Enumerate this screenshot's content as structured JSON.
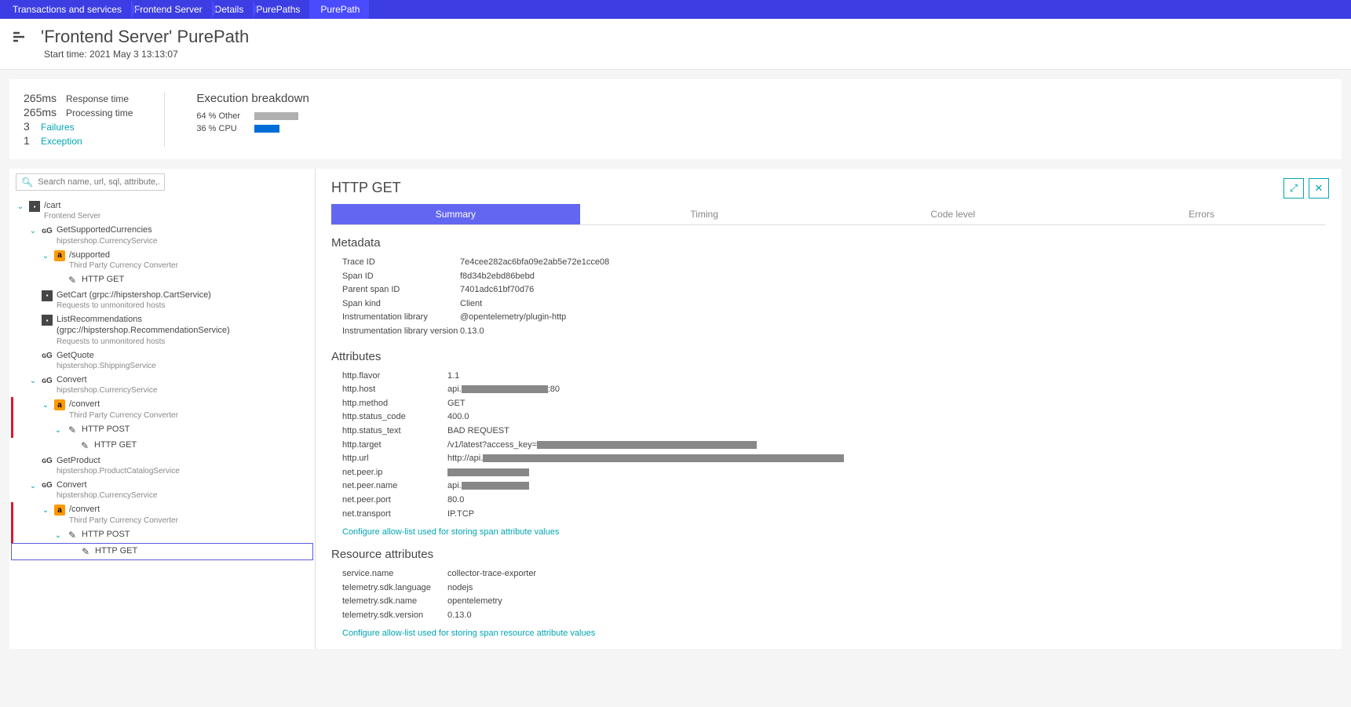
{
  "breadcrumbs": [
    "Transactions and services",
    "Frontend Server",
    "Details",
    "PurePaths",
    "PurePath"
  ],
  "header": {
    "title": "'Frontend Server' PurePath",
    "subtitle": "Start time: 2021 May 3 13:13:07"
  },
  "summary": {
    "response_time_value": "265ms",
    "response_time_label": "Response time",
    "processing_time_value": "265ms",
    "processing_time_label": "Processing time",
    "failures_count": "3",
    "failures_label": "Failures",
    "exceptions_count": "1",
    "exceptions_label": "Exception",
    "exec_title": "Execution breakdown",
    "other_pct": "64 % Other",
    "other_bar_width": 56,
    "cpu_pct": "36 % CPU",
    "cpu_bar_width": 32
  },
  "search": {
    "placeholder": "Search name, url, sql, attribute,..."
  },
  "tree": [
    {
      "indent": 0,
      "chev": true,
      "icon": "dark",
      "title": "/cart",
      "sub": "Frontend Server",
      "err": false
    },
    {
      "indent": 1,
      "chev": true,
      "icon": "grpc",
      "title": "GetSupportedCurrencies",
      "sub": "hipstershop.CurrencyService",
      "err": false
    },
    {
      "indent": 2,
      "chev": true,
      "icon": "amazon",
      "title": "/supported",
      "sub": "Third Party Currency Converter",
      "err": false
    },
    {
      "indent": 3,
      "chev": false,
      "icon": "wand",
      "title": "HTTP GET",
      "sub": "",
      "err": false
    },
    {
      "indent": 1,
      "chev": false,
      "icon": "dark",
      "title": "GetCart (grpc://hipstershop.CartService)",
      "sub": "Requests to unmonitored hosts",
      "err": false
    },
    {
      "indent": 1,
      "chev": false,
      "icon": "dark",
      "title": "ListRecommendations (grpc://hipstershop.RecommendationService)",
      "sub": "Requests to unmonitored hosts",
      "err": false
    },
    {
      "indent": 1,
      "chev": false,
      "icon": "grpc",
      "title": "GetQuote",
      "sub": "hipstershop.ShippingService",
      "err": false
    },
    {
      "indent": 1,
      "chev": true,
      "icon": "grpc",
      "title": "Convert",
      "sub": "hipstershop.CurrencyService",
      "err": false
    },
    {
      "indent": 2,
      "chev": true,
      "icon": "amazon",
      "title": "/convert",
      "sub": "Third Party Currency Converter",
      "err": true
    },
    {
      "indent": 3,
      "chev": true,
      "icon": "wand",
      "title": "HTTP POST",
      "sub": "",
      "err": true
    },
    {
      "indent": 4,
      "chev": false,
      "icon": "wand",
      "title": "HTTP GET",
      "sub": "",
      "err": false
    },
    {
      "indent": 1,
      "chev": false,
      "icon": "grpc",
      "title": "GetProduct",
      "sub": "hipstershop.ProductCatalogService",
      "err": false
    },
    {
      "indent": 1,
      "chev": true,
      "icon": "grpc",
      "title": "Convert",
      "sub": "hipstershop.CurrencyService",
      "err": false
    },
    {
      "indent": 2,
      "chev": true,
      "icon": "amazon",
      "title": "/convert",
      "sub": "Third Party Currency Converter",
      "err": true
    },
    {
      "indent": 3,
      "chev": true,
      "icon": "wand",
      "title": "HTTP POST",
      "sub": "",
      "err": true
    },
    {
      "indent": 4,
      "chev": false,
      "icon": "wand",
      "title": "HTTP GET",
      "sub": "",
      "err": false,
      "selected": true
    }
  ],
  "detail": {
    "title": "HTTP GET",
    "tabs": [
      "Summary",
      "Timing",
      "Code level",
      "Errors"
    ],
    "active_tab": 0,
    "metadata_title": "Metadata",
    "metadata": [
      {
        "k": "Trace ID",
        "v": "7e4cee282ac6bfa09e2ab5e72e1cce08"
      },
      {
        "k": "Span ID",
        "v": "f8d34b2ebd86bebd"
      },
      {
        "k": "Parent span ID",
        "v": "7401adc61bf70d76"
      },
      {
        "k": "Span kind",
        "v": "Client"
      },
      {
        "k": "Instrumentation library",
        "v": "@opentelemetry/plugin-http"
      },
      {
        "k": "Instrumentation library version",
        "v": "0.13.0"
      }
    ],
    "attributes_title": "Attributes",
    "attributes": [
      {
        "k": "http.flavor",
        "v": "1.1"
      },
      {
        "k": "http.host",
        "v": "api.",
        "redact_after": 110,
        "suffix": ":80"
      },
      {
        "k": "http.method",
        "v": "GET"
      },
      {
        "k": "http.status_code",
        "v": "400.0"
      },
      {
        "k": "http.status_text",
        "v": "BAD REQUEST"
      },
      {
        "k": "http.target",
        "v": "/v1/latest?access_key=",
        "redact_after": 280
      },
      {
        "k": "http.url",
        "v": "http://api.",
        "redact_after": 460
      },
      {
        "k": "net.peer.ip",
        "v": "",
        "redact_after": 104
      },
      {
        "k": "net.peer.name",
        "v": "api.",
        "redact_after": 86
      },
      {
        "k": "net.peer.port",
        "v": "80.0"
      },
      {
        "k": "net.transport",
        "v": "IP.TCP"
      }
    ],
    "attributes_link": "Configure allow-list used for storing span attribute values",
    "resource_title": "Resource attributes",
    "resource": [
      {
        "k": "service.name",
        "v": "collector-trace-exporter"
      },
      {
        "k": "telemetry.sdk.language",
        "v": "nodejs"
      },
      {
        "k": "telemetry.sdk.name",
        "v": "opentelemetry"
      },
      {
        "k": "telemetry.sdk.version",
        "v": "0.13.0"
      }
    ],
    "resource_link": "Configure allow-list used for storing span resource attribute values"
  }
}
